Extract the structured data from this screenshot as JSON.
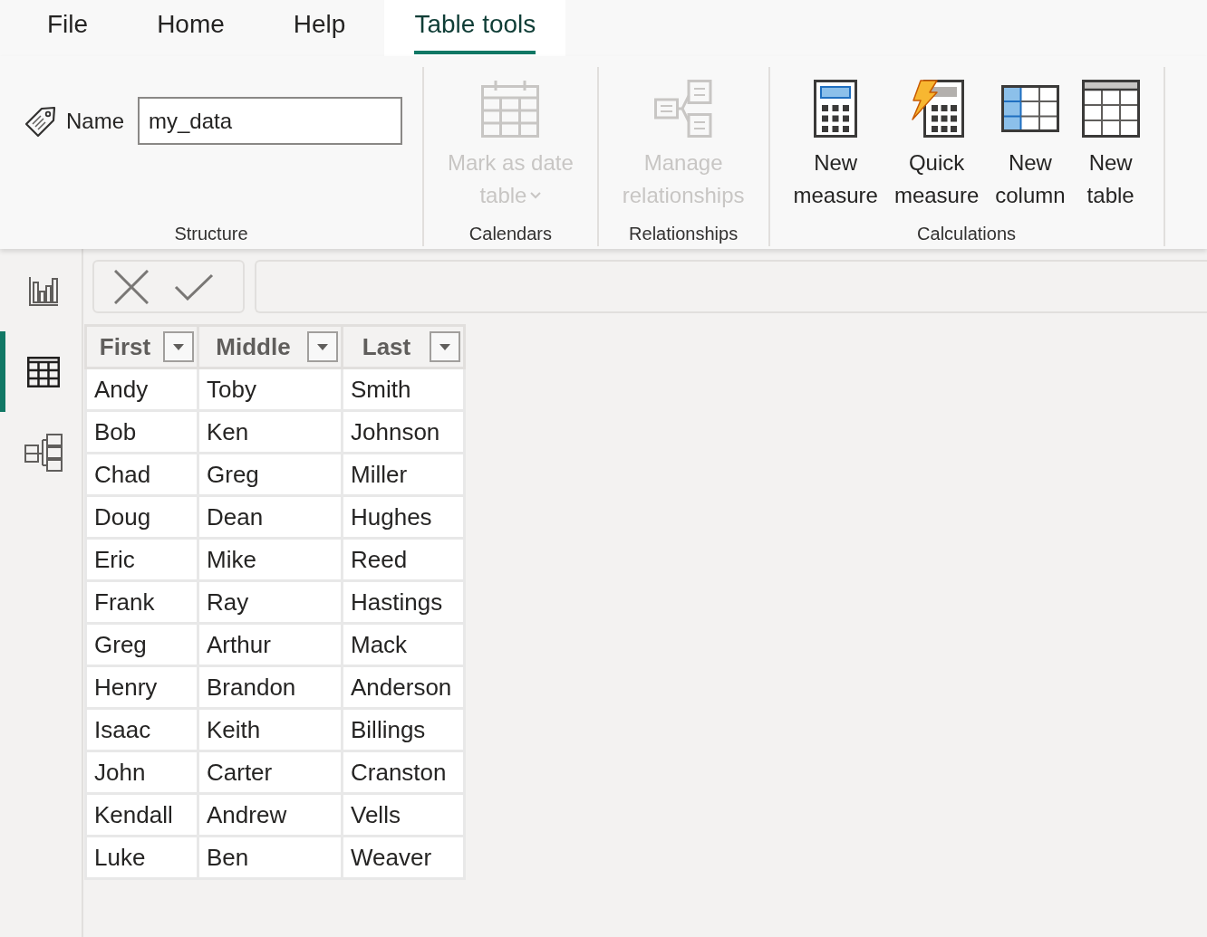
{
  "menu_tabs": [
    {
      "label": "File",
      "selected": false
    },
    {
      "label": "Home",
      "selected": false
    },
    {
      "label": "Help",
      "selected": false
    },
    {
      "label": "Table tools",
      "selected": true
    }
  ],
  "ribbon": {
    "groups": [
      {
        "kind": "name",
        "label": "Structure",
        "name_field": {
          "label": "Name",
          "value": "my_data"
        }
      },
      {
        "kind": "buttons",
        "label": "Calendars",
        "buttons": [
          {
            "kind": "date_table",
            "lines": [
              "Mark as date",
              "table"
            ],
            "disabled": true,
            "dropdown": true
          }
        ]
      },
      {
        "kind": "buttons",
        "label": "Relationships",
        "buttons": [
          {
            "kind": "relationships",
            "lines": [
              "Manage",
              "relationships"
            ],
            "disabled": true
          }
        ]
      },
      {
        "kind": "buttons",
        "label": "Calculations",
        "buttons": [
          {
            "kind": "measure",
            "lines": [
              "New",
              "measure"
            ],
            "disabled": false
          },
          {
            "kind": "quick_measure",
            "lines": [
              "Quick",
              "measure"
            ],
            "disabled": false
          },
          {
            "kind": "column",
            "lines": [
              "New",
              "column"
            ],
            "disabled": false
          },
          {
            "kind": "table",
            "lines": [
              "New",
              "table"
            ],
            "disabled": false
          }
        ]
      }
    ]
  },
  "nav_rail": {
    "items": [
      {
        "kind": "report",
        "selected": false
      },
      {
        "kind": "data",
        "selected": true
      },
      {
        "kind": "model",
        "selected": false
      }
    ]
  },
  "table": {
    "columns": [
      {
        "label": "First"
      },
      {
        "label": "Middle"
      },
      {
        "label": "Last"
      }
    ],
    "rows": [
      [
        "Andy",
        "Toby",
        "Smith"
      ],
      [
        "Bob",
        "Ken",
        "Johnson"
      ],
      [
        "Chad",
        "Greg",
        "Miller"
      ],
      [
        "Doug",
        "Dean",
        "Hughes"
      ],
      [
        "Eric",
        "Mike",
        "Reed"
      ],
      [
        "Frank",
        "Ray",
        "Hastings"
      ],
      [
        "Greg",
        "Arthur",
        "Mack"
      ],
      [
        "Henry",
        "Brandon",
        "Anderson"
      ],
      [
        "Isaac",
        "Keith",
        "Billings"
      ],
      [
        "John",
        "Carter",
        "Cranston"
      ],
      [
        "Kendall",
        "Andrew",
        "Vells"
      ],
      [
        "Luke",
        "Ben",
        "Weaver"
      ]
    ]
  }
}
